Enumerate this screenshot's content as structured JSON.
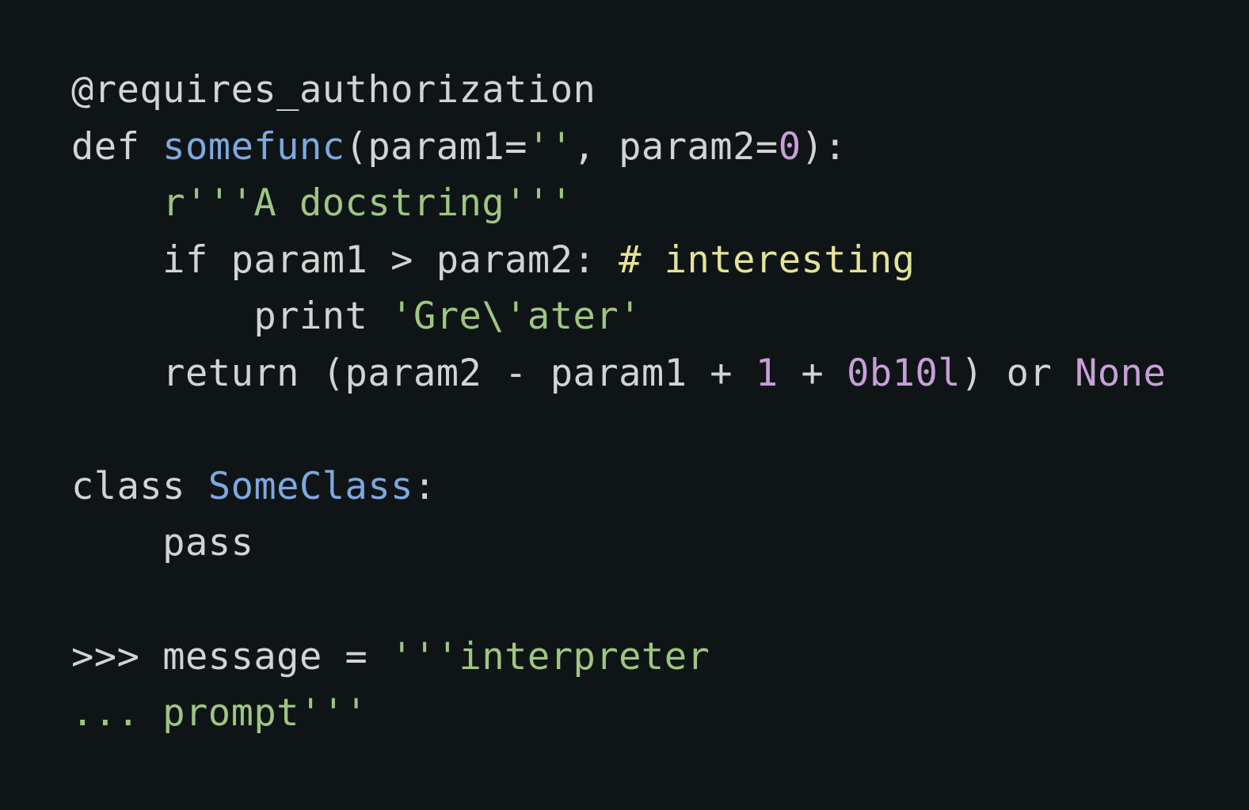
{
  "colors": {
    "background": "#0f1516",
    "plain": "#d2d4d3",
    "function": "#7fa8e0",
    "number": "#c89fd8",
    "string": "#9ec682",
    "comment": "#e6e29a"
  },
  "code": {
    "lines": [
      [
        {
          "t": "@requires_authorization",
          "k": "plain"
        }
      ],
      [
        {
          "t": "def ",
          "k": "plain"
        },
        {
          "t": "somefunc",
          "k": "func"
        },
        {
          "t": "(param1=",
          "k": "plain"
        },
        {
          "t": "''",
          "k": "str"
        },
        {
          "t": ", param2=",
          "k": "plain"
        },
        {
          "t": "0",
          "k": "num"
        },
        {
          "t": "):",
          "k": "plain"
        }
      ],
      [
        {
          "t": "    ",
          "k": "plain"
        },
        {
          "t": "r'''A docstring'''",
          "k": "str"
        }
      ],
      [
        {
          "t": "    if param1 > param2: ",
          "k": "plain"
        },
        {
          "t": "# interesting",
          "k": "comment"
        }
      ],
      [
        {
          "t": "        print ",
          "k": "plain"
        },
        {
          "t": "'Gre\\'ater'",
          "k": "str"
        }
      ],
      [
        {
          "t": "    return (param2 - param1 + ",
          "k": "plain"
        },
        {
          "t": "1",
          "k": "num"
        },
        {
          "t": " + ",
          "k": "plain"
        },
        {
          "t": "0b10l",
          "k": "num"
        },
        {
          "t": ") or ",
          "k": "plain"
        },
        {
          "t": "None",
          "k": "const"
        }
      ],
      [],
      [
        {
          "t": "class ",
          "k": "plain"
        },
        {
          "t": "SomeClass",
          "k": "class"
        },
        {
          "t": ":",
          "k": "plain"
        }
      ],
      [
        {
          "t": "    pass",
          "k": "plain"
        }
      ],
      [],
      [
        {
          "t": ">>> ",
          "k": "prompt"
        },
        {
          "t": "message = ",
          "k": "plain"
        },
        {
          "t": "'''interpreter",
          "k": "str"
        }
      ],
      [
        {
          "t": "... ",
          "k": "str"
        },
        {
          "t": "prompt'''",
          "k": "str"
        }
      ]
    ]
  }
}
